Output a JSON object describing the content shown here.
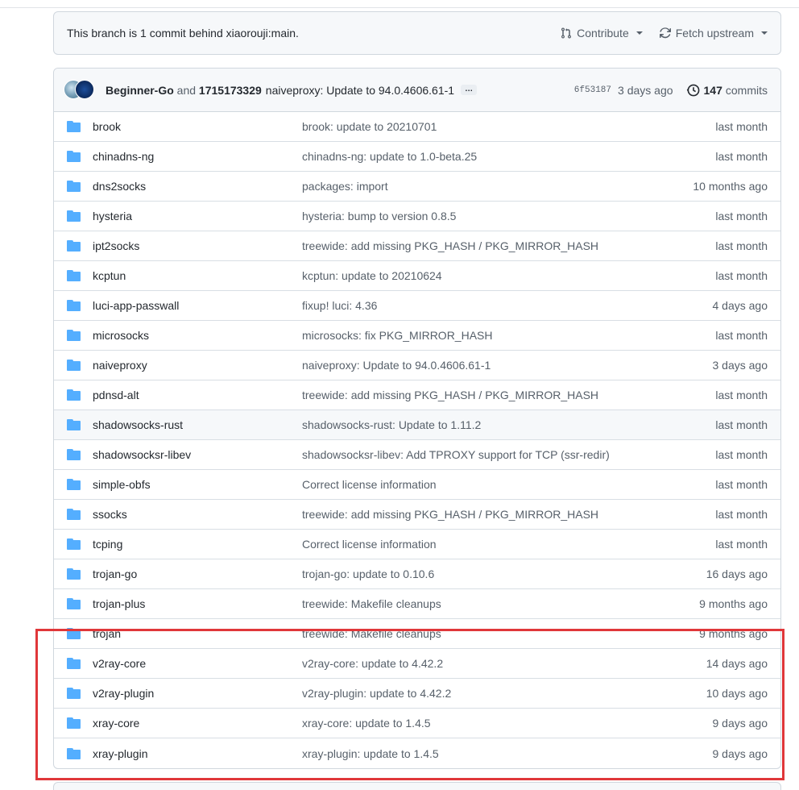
{
  "branch_bar": {
    "status_text": "This branch is 1 commit behind xiaorouji:main.",
    "contribute_label": "Contribute",
    "fetch_label": "Fetch upstream"
  },
  "latest_commit": {
    "author1": "Beginner-Go",
    "and_text": "and",
    "author2": "1715173329",
    "message": "naiveproxy: Update to 94.0.4606.61-1",
    "ellipsis": "…",
    "sha": "6f53187",
    "age": "3 days ago",
    "commit_count": "147",
    "commits_label": "commits"
  },
  "files": [
    {
      "name": "brook",
      "message": "brook: update to 20210701",
      "age": "last month"
    },
    {
      "name": "chinadns-ng",
      "message": "chinadns-ng: update to 1.0-beta.25",
      "age": "last month"
    },
    {
      "name": "dns2socks",
      "message": "packages: import",
      "age": "10 months ago"
    },
    {
      "name": "hysteria",
      "message": "hysteria: bump to version 0.8.5",
      "age": "last month"
    },
    {
      "name": "ipt2socks",
      "message": "treewide: add missing PKG_HASH / PKG_MIRROR_HASH",
      "age": "last month"
    },
    {
      "name": "kcptun",
      "message": "kcptun: update to 20210624",
      "age": "last month"
    },
    {
      "name": "luci-app-passwall",
      "message": "fixup! luci: 4.36",
      "age": "4 days ago"
    },
    {
      "name": "microsocks",
      "message": "microsocks: fix PKG_MIRROR_HASH",
      "age": "last month"
    },
    {
      "name": "naiveproxy",
      "message": "naiveproxy: Update to 94.0.4606.61-1",
      "age": "3 days ago"
    },
    {
      "name": "pdnsd-alt",
      "message": "treewide: add missing PKG_HASH / PKG_MIRROR_HASH",
      "age": "last month"
    },
    {
      "name": "shadowsocks-rust",
      "message": "shadowsocks-rust: Update to 1.11.2",
      "age": "last month"
    },
    {
      "name": "shadowsocksr-libev",
      "message": "shadowsocksr-libev: Add TPROXY support for TCP (ssr-redir)",
      "age": "last month"
    },
    {
      "name": "simple-obfs",
      "message": "Correct license information",
      "age": "last month"
    },
    {
      "name": "ssocks",
      "message": "treewide: add missing PKG_HASH / PKG_MIRROR_HASH",
      "age": "last month"
    },
    {
      "name": "tcping",
      "message": "Correct license information",
      "age": "last month"
    },
    {
      "name": "trojan-go",
      "message": "trojan-go: update to 0.10.6",
      "age": "16 days ago"
    },
    {
      "name": "trojan-plus",
      "message": "treewide: Makefile cleanups",
      "age": "9 months ago"
    },
    {
      "name": "trojan",
      "message": "treewide: Makefile cleanups",
      "age": "9 months ago"
    },
    {
      "name": "v2ray-core",
      "message": "v2ray-core: update to 4.42.2",
      "age": "14 days ago"
    },
    {
      "name": "v2ray-plugin",
      "message": "v2ray-plugin: update to 4.42.2",
      "age": "10 days ago"
    },
    {
      "name": "xray-core",
      "message": "xray-core: update to 1.4.5",
      "age": "9 days ago"
    },
    {
      "name": "xray-plugin",
      "message": "xray-plugin: update to 1.4.5",
      "age": "9 days ago"
    }
  ],
  "colors": {
    "folder": "#54aeff",
    "highlight_border": "#e0373a"
  }
}
